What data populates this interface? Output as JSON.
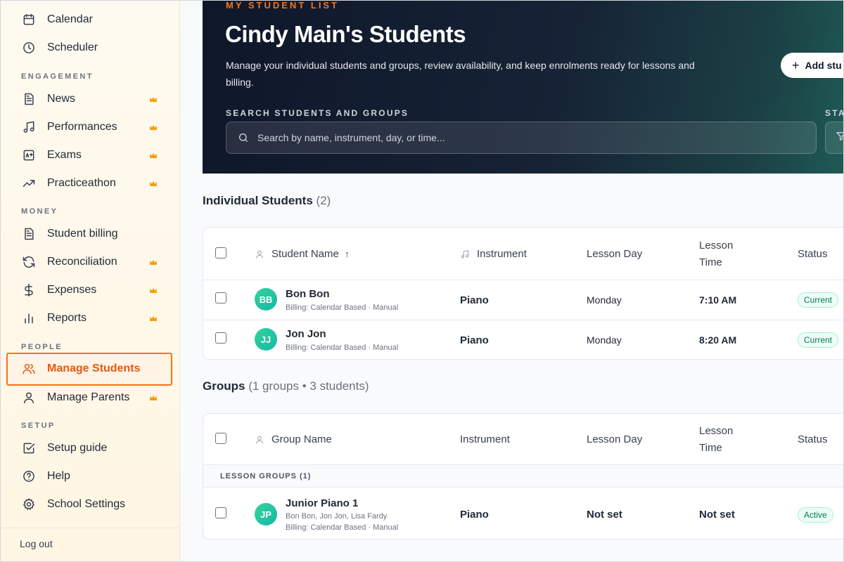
{
  "sidebar": {
    "top_items": [
      {
        "label": "Calendar",
        "icon": "calendar-icon"
      },
      {
        "label": "Scheduler",
        "icon": "clock-icon"
      }
    ],
    "sections": {
      "engagement": "ENGAGEMENT",
      "money": "MONEY",
      "people": "PEOPLE",
      "setup": "SETUP"
    },
    "engagement_items": [
      {
        "label": "News",
        "icon": "newspaper-icon",
        "premium": true
      },
      {
        "label": "Performances",
        "icon": "music-note-icon",
        "premium": true
      },
      {
        "label": "Exams",
        "icon": "grade-icon",
        "premium": true
      },
      {
        "label": "Practiceathon",
        "icon": "trending-up-icon",
        "premium": true
      }
    ],
    "money_items": [
      {
        "label": "Student billing",
        "icon": "document-icon",
        "premium": false
      },
      {
        "label": "Reconciliation",
        "icon": "refresh-icon",
        "premium": true
      },
      {
        "label": "Expenses",
        "icon": "dollar-icon",
        "premium": true
      },
      {
        "label": "Reports",
        "icon": "bar-chart-icon",
        "premium": true
      }
    ],
    "people_items": [
      {
        "label": "Manage Students",
        "icon": "users-icon",
        "premium": false,
        "active": true
      },
      {
        "label": "Manage Parents",
        "icon": "user-icon",
        "premium": true
      }
    ],
    "setup_items": [
      {
        "label": "Setup guide",
        "icon": "checkbox-icon"
      },
      {
        "label": "Help",
        "icon": "help-circle-icon"
      },
      {
        "label": "School Settings",
        "icon": "gear-icon"
      }
    ],
    "logout": "Log out",
    "accent_color": "#ea580c",
    "premium_color": "#f59e0b"
  },
  "hero": {
    "eyebrow": "MY STUDENT LIST",
    "title": "Cindy Main's Students",
    "description": "Manage your individual students and groups, review availability, and keep enrolments ready for lessons and billing.",
    "search_label": "SEARCH STUDENTS AND GROUPS",
    "search_placeholder": "Search by name, instrument, day, or time...",
    "status_label": "STA",
    "add_button": "Add stu"
  },
  "individual": {
    "title": "Individual Students",
    "count": "(2)",
    "headers": {
      "name": "Student Name",
      "sort": "↑",
      "instrument": "Instrument",
      "day": "Lesson Day",
      "time_line1": "Lesson",
      "time_line2": "Time",
      "status": "Status"
    },
    "rows": [
      {
        "initials": "BB",
        "name": "Bon Bon",
        "billing": "Billing: Calendar Based · Manual",
        "instrument": "Piano",
        "day": "Monday",
        "time": "7:10 AM",
        "status": "Current"
      },
      {
        "initials": "JJ",
        "name": "Jon Jon",
        "billing": "Billing: Calendar Based · Manual",
        "instrument": "Piano",
        "day": "Monday",
        "time": "8:20 AM",
        "status": "Current"
      }
    ]
  },
  "groups": {
    "title": "Groups",
    "count": "(1 groups • 3 students)",
    "headers": {
      "name": "Group Name",
      "instrument": "Instrument",
      "day": "Lesson Day",
      "time_line1": "Lesson",
      "time_line2": "Time",
      "status": "Status"
    },
    "band": "LESSON GROUPS (1)",
    "rows": [
      {
        "initials": "JP",
        "name": "Junior Piano 1",
        "members": "Bon Bon, Jon Jon, Lisa Fardy",
        "billing": "Billing: Calendar Based · Manual",
        "instrument": "Piano",
        "day": "Not set",
        "time": "Not set",
        "status": "Active"
      }
    ]
  }
}
